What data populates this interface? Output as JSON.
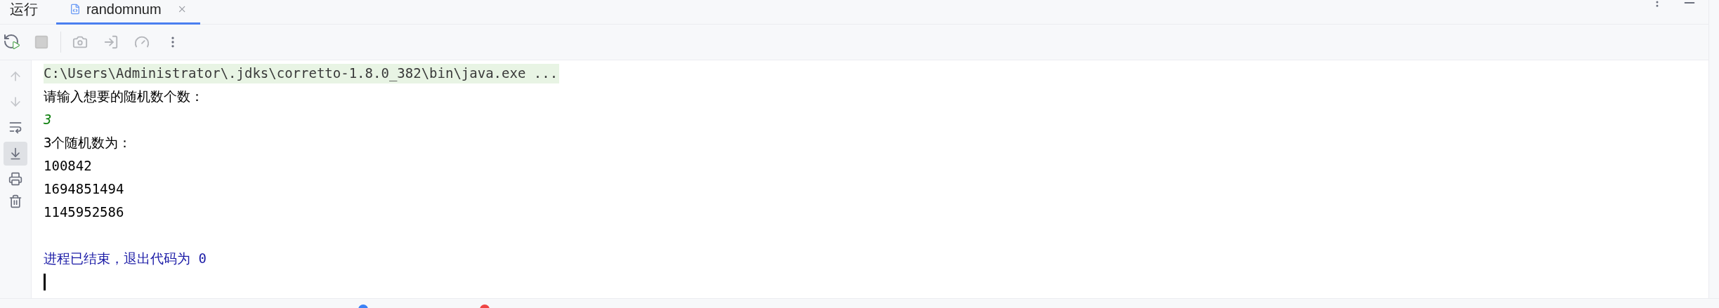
{
  "panel": {
    "title": "运行"
  },
  "tabs": [
    {
      "label": "randomnum",
      "selected": true
    }
  ],
  "console": {
    "lines": [
      {
        "kind": "command",
        "text": "C:\\Users\\Administrator\\.jdks\\corretto-1.8.0_382\\bin\\java.exe ..."
      },
      {
        "kind": "output",
        "text": "请输入想要的随机数个数："
      },
      {
        "kind": "input",
        "text": "3"
      },
      {
        "kind": "output",
        "text": "3个随机数为："
      },
      {
        "kind": "output",
        "text": "100842"
      },
      {
        "kind": "output",
        "text": "1694851494"
      },
      {
        "kind": "output",
        "text": "1145952586"
      },
      {
        "kind": "blank"
      },
      {
        "kind": "exit",
        "text": "进程已结束，退出代码为 0"
      }
    ]
  }
}
